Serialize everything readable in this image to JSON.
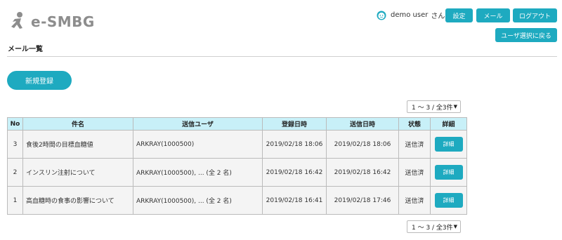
{
  "app": {
    "logo_text": "e-SMBG"
  },
  "header": {
    "user_name": "demo user",
    "user_suffix": "さん",
    "settings_label": "設定",
    "mail_label": "メール",
    "logout_label": "ログアウト",
    "back_label": "ユーザ選択に戻る"
  },
  "page": {
    "title": "メール一覧",
    "new_button": "新規登録"
  },
  "pager": {
    "top": "1 〜 3 / 全3件",
    "bottom": "1 〜 3 / 全3件"
  },
  "table": {
    "headers": {
      "no": "No",
      "subject": "件名",
      "sender": "送信ユーザ",
      "registered": "登録日時",
      "sent": "送信日時",
      "status": "状態",
      "detail": "詳細"
    },
    "rows": [
      {
        "no": "3",
        "subject": "食後2時間の目標血糖値",
        "sender": "ARKRAY(1000500)",
        "registered": "2019/02/18 18:06",
        "sent": "2019/02/18 18:06",
        "status": "送信済",
        "detail": "詳細"
      },
      {
        "no": "2",
        "subject": "インスリン注射について",
        "sender": "ARKRAY(1000500), ... (全 2 名)",
        "registered": "2019/02/18 16:42",
        "sent": "2019/02/18 16:42",
        "status": "送信済",
        "detail": "詳細"
      },
      {
        "no": "1",
        "subject": "高血糖時の食事の影響について",
        "sender": "ARKRAY(1000500), ... (全 2 名)",
        "registered": "2019/02/18 16:41",
        "sent": "2019/02/18 17:46",
        "status": "送信済",
        "detail": "詳細"
      }
    ]
  },
  "icons": {
    "logo": "running-figure-icon",
    "avatar": "smiley-face-icon",
    "dropdown": "triangle-down-icon"
  },
  "colors": {
    "accent": "#1eaac0",
    "header_bg": "#c8f0f8",
    "logo_gray": "#8d8d8d"
  }
}
